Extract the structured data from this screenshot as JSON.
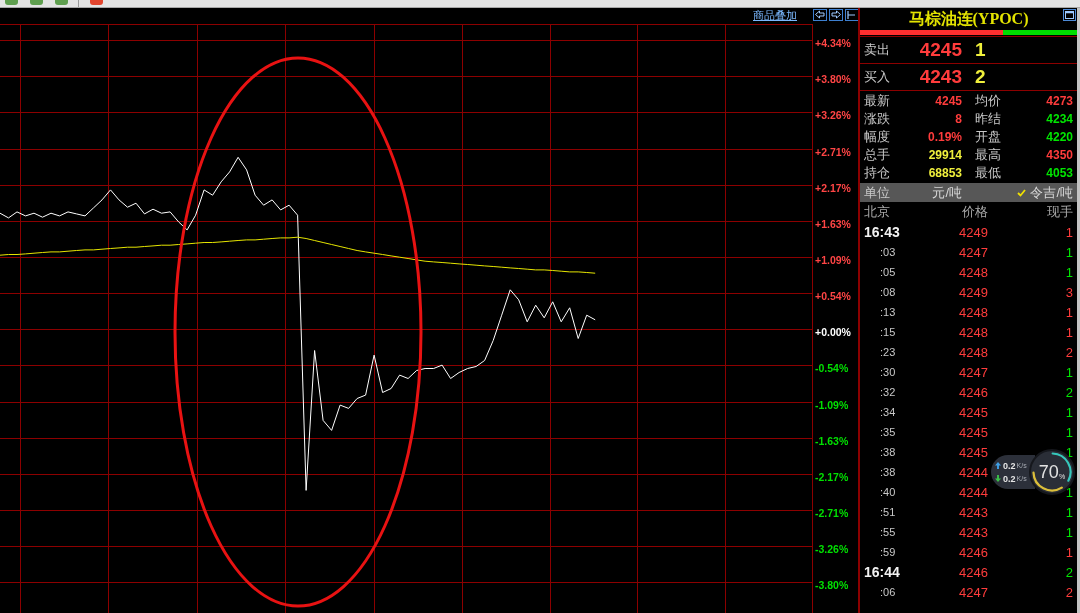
{
  "toolbar": {
    "groups": [
      {
        "buttons": [
          {
            "color": "#5f9f4f"
          },
          {
            "color": "#5f9f4f"
          },
          {
            "color": "#5f9f4f"
          }
        ]
      },
      {
        "buttons": [
          {
            "color": "#e2452e"
          }
        ]
      }
    ]
  },
  "chart": {
    "overlay_link": "商品叠加",
    "chart_data": {
      "type": "line",
      "grid": true,
      "categories": [
        null,
        null,
        null,
        null,
        null,
        null,
        null,
        null,
        null,
        null,
        null,
        null,
        null,
        null,
        null,
        null,
        null,
        null,
        null,
        null,
        null,
        null,
        null,
        null,
        null,
        null,
        null,
        null,
        null,
        null,
        null,
        null,
        null,
        null,
        null,
        null,
        null,
        null,
        null,
        null,
        null,
        null,
        null,
        null,
        null,
        null,
        null,
        null,
        null,
        null,
        null,
        null,
        null,
        null,
        null,
        null,
        null,
        null,
        null,
        null,
        null,
        null,
        null,
        null,
        null,
        null,
        null,
        null,
        null,
        null,
        null,
        null,
        null,
        null,
        null,
        null,
        null,
        null,
        null,
        null,
        null,
        null,
        null,
        null,
        null,
        null,
        null,
        null,
        null,
        null,
        null,
        null,
        null,
        null,
        null,
        null
      ],
      "ylim": [
        -4.26,
        4.58
      ],
      "yticks": [
        {
          "value": 4.34,
          "label": "+4.34%"
        },
        {
          "value": 3.8,
          "label": "+3.80%"
        },
        {
          "value": 3.26,
          "label": "+3.26%"
        },
        {
          "value": 2.71,
          "label": "+2.71%"
        },
        {
          "value": 2.17,
          "label": "+2.17%"
        },
        {
          "value": 1.63,
          "label": "+1.63%"
        },
        {
          "value": 1.09,
          "label": "+1.09%"
        },
        {
          "value": 0.54,
          "label": "+0.54%"
        },
        {
          "value": 0,
          "label": "+0.00%"
        },
        {
          "value": -0.54,
          "label": "-0.54%"
        },
        {
          "value": -1.09,
          "label": "-1.09%"
        },
        {
          "value": -1.63,
          "label": "-1.63%"
        },
        {
          "value": -2.17,
          "label": "-2.17%"
        },
        {
          "value": -2.71,
          "label": "-2.71%"
        },
        {
          "value": -3.26,
          "label": "-3.26%"
        },
        {
          "value": -3.8,
          "label": "-3.80%"
        }
      ],
      "series": [
        {
          "color": "#ffffff",
          "values": [
            1.74,
            1.67,
            1.76,
            1.7,
            1.74,
            1.68,
            1.74,
            1.7,
            1.76,
            1.73,
            1.7,
            1.82,
            1.94,
            2.09,
            1.94,
            1.83,
            1.89,
            1.73,
            1.8,
            1.74,
            1.76,
            1.61,
            1.49,
            1.71,
            2.09,
            2.01,
            2.21,
            2.36,
            2.58,
            2.39,
            2.01,
            1.86,
            1.94,
            1.79,
            1.86,
            1.71,
            -2.42,
            -0.32,
            -1.37,
            -1.52,
            -1.14,
            -1.19,
            -1.04,
            -0.99,
            -0.39,
            -0.95,
            -0.89,
            -0.69,
            -0.74,
            -0.62,
            -0.59,
            -0.59,
            -0.54,
            -0.74,
            -0.65,
            -0.59,
            -0.56,
            -0.47,
            -0.17,
            0.21,
            0.59,
            0.44,
            0.11,
            0.36,
            0.17,
            0.41,
            0.11,
            0.32,
            -0.14,
            0.21,
            0.14,
            null,
            null,
            null,
            null,
            null,
            null,
            null,
            null,
            null,
            null,
            null,
            null,
            null,
            null,
            null,
            null,
            null,
            null,
            null,
            null,
            null,
            null,
            null,
            null,
            null
          ]
        },
        {
          "color": "#e6e600",
          "values": [
            1.11,
            1.12,
            1.12,
            1.13,
            1.14,
            1.15,
            1.16,
            1.16,
            1.17,
            1.18,
            1.19,
            1.19,
            1.2,
            1.21,
            1.22,
            1.23,
            1.23,
            1.24,
            1.25,
            1.26,
            1.26,
            1.27,
            1.28,
            1.29,
            1.3,
            1.3,
            1.31,
            1.32,
            1.33,
            1.34,
            1.34,
            1.35,
            1.36,
            1.37,
            1.37,
            1.38,
            1.36,
            1.33,
            1.3,
            1.27,
            1.24,
            1.21,
            1.18,
            1.16,
            1.14,
            1.12,
            1.1,
            1.08,
            1.06,
            1.04,
            1.02,
            1.01,
            1.0,
            0.99,
            0.98,
            0.97,
            0.96,
            0.95,
            0.94,
            0.93,
            0.92,
            0.91,
            0.9,
            0.89,
            0.89,
            0.88,
            0.87,
            0.86,
            0.86,
            0.85,
            0.84,
            null,
            null,
            null,
            null,
            null,
            null,
            null,
            null,
            null,
            null,
            null,
            null,
            null,
            null,
            null,
            null,
            null,
            null,
            null,
            null,
            null,
            null,
            null,
            null,
            null
          ]
        }
      ]
    }
  },
  "quote_panel": {
    "title": "马棕油连(YPOC)",
    "ratio_bar": {
      "level": 0.66
    },
    "ask": {
      "label": "卖出",
      "price": "4245",
      "volume": "1"
    },
    "bid": {
      "label": "买入",
      "price": "4243",
      "volume": "2"
    },
    "stats": [
      {
        "label": "最新",
        "value": "4245",
        "color": "#ff3c3c"
      },
      {
        "label": "均价",
        "value": "4273",
        "color": "#ff3c3c"
      },
      {
        "label": "涨跌",
        "value": "8",
        "color": "#ff3c3c"
      },
      {
        "label": "昨结",
        "value": "4234",
        "color": "#00e600"
      },
      {
        "label": "幅度",
        "value": "0.19%",
        "color": "#ff3c3c"
      },
      {
        "label": "开盘",
        "value": "4220",
        "color": "#00e600"
      },
      {
        "label": "总手",
        "value": "29914",
        "color": "#f0f03c"
      },
      {
        "label": "最高",
        "value": "4350",
        "color": "#ff3c3c"
      },
      {
        "label": "持仓",
        "value": "68853",
        "color": "#f0f03c"
      },
      {
        "label": "最低",
        "value": "4053",
        "color": "#00e600"
      }
    ],
    "unit_row": {
      "label": "单位",
      "value": "元/吨",
      "option": {
        "label": "令吉/吨",
        "checked": true
      }
    },
    "trade_columns": [
      "北京",
      "价格",
      "现手"
    ],
    "trades": [
      {
        "time": "16:43",
        "kind": "full",
        "price": "4249",
        "volume": "1",
        "color": "#ff3c3c"
      },
      {
        "time": ":03",
        "kind": "short",
        "price": "4247",
        "volume": "1",
        "color": "#00e600"
      },
      {
        "time": ":05",
        "kind": "short",
        "price": "4248",
        "volume": "1",
        "color": "#00e600"
      },
      {
        "time": ":08",
        "kind": "short",
        "price": "4249",
        "volume": "3",
        "color": "#ff3c3c"
      },
      {
        "time": ":13",
        "kind": "short",
        "price": "4248",
        "volume": "1",
        "color": "#ff3c3c"
      },
      {
        "time": ":15",
        "kind": "short",
        "price": "4248",
        "volume": "1",
        "color": "#ff3c3c"
      },
      {
        "time": ":23",
        "kind": "short",
        "price": "4248",
        "volume": "2",
        "color": "#ff3c3c"
      },
      {
        "time": ":30",
        "kind": "short",
        "price": "4247",
        "volume": "1",
        "color": "#00e600"
      },
      {
        "time": ":32",
        "kind": "short",
        "price": "4246",
        "volume": "2",
        "color": "#00e600"
      },
      {
        "time": ":34",
        "kind": "short",
        "price": "4245",
        "volume": "1",
        "color": "#00e600"
      },
      {
        "time": ":35",
        "kind": "short",
        "price": "4245",
        "volume": "1",
        "color": "#00e600"
      },
      {
        "time": ":38",
        "kind": "short",
        "price": "4245",
        "volume": "1",
        "color": "#00e600"
      },
      {
        "time": ":38",
        "kind": "short",
        "price": "4244"
      },
      {
        "time": ":40",
        "kind": "short",
        "price": "4244",
        "volume": "1",
        "color": "#00e600"
      },
      {
        "time": ":51",
        "kind": "short",
        "price": "4243",
        "volume": "1",
        "color": "#00e600"
      },
      {
        "time": ":55",
        "kind": "short",
        "price": "4243",
        "volume": "1",
        "color": "#00e600"
      },
      {
        "time": ":59",
        "kind": "short",
        "price": "4246",
        "volume": "1",
        "color": "#ff3c3c"
      },
      {
        "time": "16:44",
        "kind": "full",
        "price": "4246",
        "volume": "2",
        "color": "#00e600"
      },
      {
        "time": ":06",
        "kind": "short",
        "price": "4247",
        "volume": "2",
        "color": "#ff3c3c"
      }
    ]
  },
  "speed_widget": {
    "upload": "0.2",
    "upload_unit": "K/s",
    "download": "0.2",
    "download_unit": "K/s",
    "percent": "70",
    "percent_sign": "%"
  }
}
